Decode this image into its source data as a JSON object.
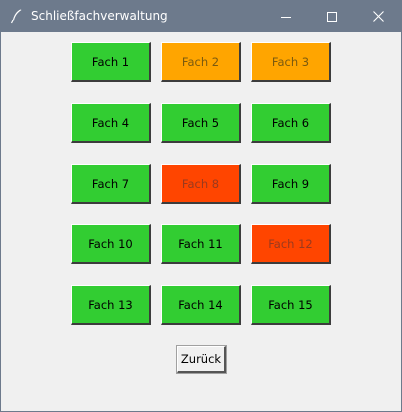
{
  "window": {
    "title": "Schließfachverwaltung",
    "controls": [
      "minimize-icon",
      "maximize-icon",
      "close-icon"
    ]
  },
  "colors": {
    "titlebar": "#6d7a8c",
    "free": "#32cd32",
    "reserved": "#ffa500",
    "occupied": "#ff4500",
    "background": "#f0f0f0"
  },
  "lockers": [
    {
      "label": "Fach 1",
      "status": "free"
    },
    {
      "label": "Fach 2",
      "status": "reserved"
    },
    {
      "label": "Fach 3",
      "status": "reserved"
    },
    {
      "label": "Fach 4",
      "status": "free"
    },
    {
      "label": "Fach 5",
      "status": "free"
    },
    {
      "label": "Fach 6",
      "status": "free"
    },
    {
      "label": "Fach 7",
      "status": "free"
    },
    {
      "label": "Fach 8",
      "status": "occupied"
    },
    {
      "label": "Fach 9",
      "status": "free"
    },
    {
      "label": "Fach 10",
      "status": "free"
    },
    {
      "label": "Fach 11",
      "status": "free"
    },
    {
      "label": "Fach 12",
      "status": "occupied"
    },
    {
      "label": "Fach 13",
      "status": "free"
    },
    {
      "label": "Fach 14",
      "status": "free"
    },
    {
      "label": "Fach 15",
      "status": "free"
    }
  ],
  "back_button": {
    "label": "Zurück"
  }
}
